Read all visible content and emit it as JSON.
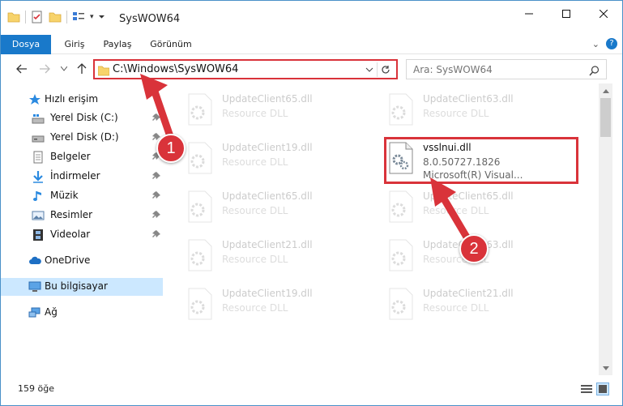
{
  "window": {
    "title": "SysWOW64"
  },
  "ribbon": {
    "tabs": [
      "Dosya",
      "Giriş",
      "Paylaş",
      "Görünüm"
    ]
  },
  "address": {
    "path": "C:\\Windows\\SysWOW64",
    "search_placeholder": "Ara: SysWOW64"
  },
  "nav": {
    "quick_access": "Hızlı erişim",
    "items": [
      "Yerel Disk (C:)",
      "Yerel Disk (D:)",
      "Belgeler",
      "İndirmeler",
      "Müzik",
      "Resimler",
      "Videolar"
    ],
    "onedrive": "OneDrive",
    "this_pc": "Bu bilgisayar",
    "network": "Ağ"
  },
  "files": {
    "left": [
      {
        "name": "UpdateClient65.dll",
        "type": "Resource DLL"
      },
      {
        "name": "UpdateClient19.dll",
        "type": "Resource DLL"
      },
      {
        "name": "UpdateClient65.dll",
        "type": "Resource DLL"
      },
      {
        "name": "UpdateClient21.dll",
        "type": "Resource DLL"
      },
      {
        "name": "UpdateClient19.dll",
        "type": "Resource DLL"
      }
    ],
    "right_top": {
      "name": "UpdateClient63.dll",
      "type": "Resource DLL"
    },
    "highlighted": {
      "name": "vsslnui.dll",
      "version": "8.0.50727.1826",
      "company": "Microsoft(R) Visual..."
    },
    "right_rest": [
      {
        "name": "UpdateClient65.dll",
        "type": "Resource DLL"
      },
      {
        "name": "UpdateClient63.dll",
        "type": "Resource DLL"
      },
      {
        "name": "UpdateClient21.dll",
        "type": "Resource DLL"
      }
    ]
  },
  "status": {
    "count": "159 öğe"
  },
  "annotations": {
    "badge1": "1",
    "badge2": "2"
  },
  "colors": {
    "accent": "#1979ca",
    "highlight": "#d9333a",
    "selected": "#cce8ff"
  }
}
